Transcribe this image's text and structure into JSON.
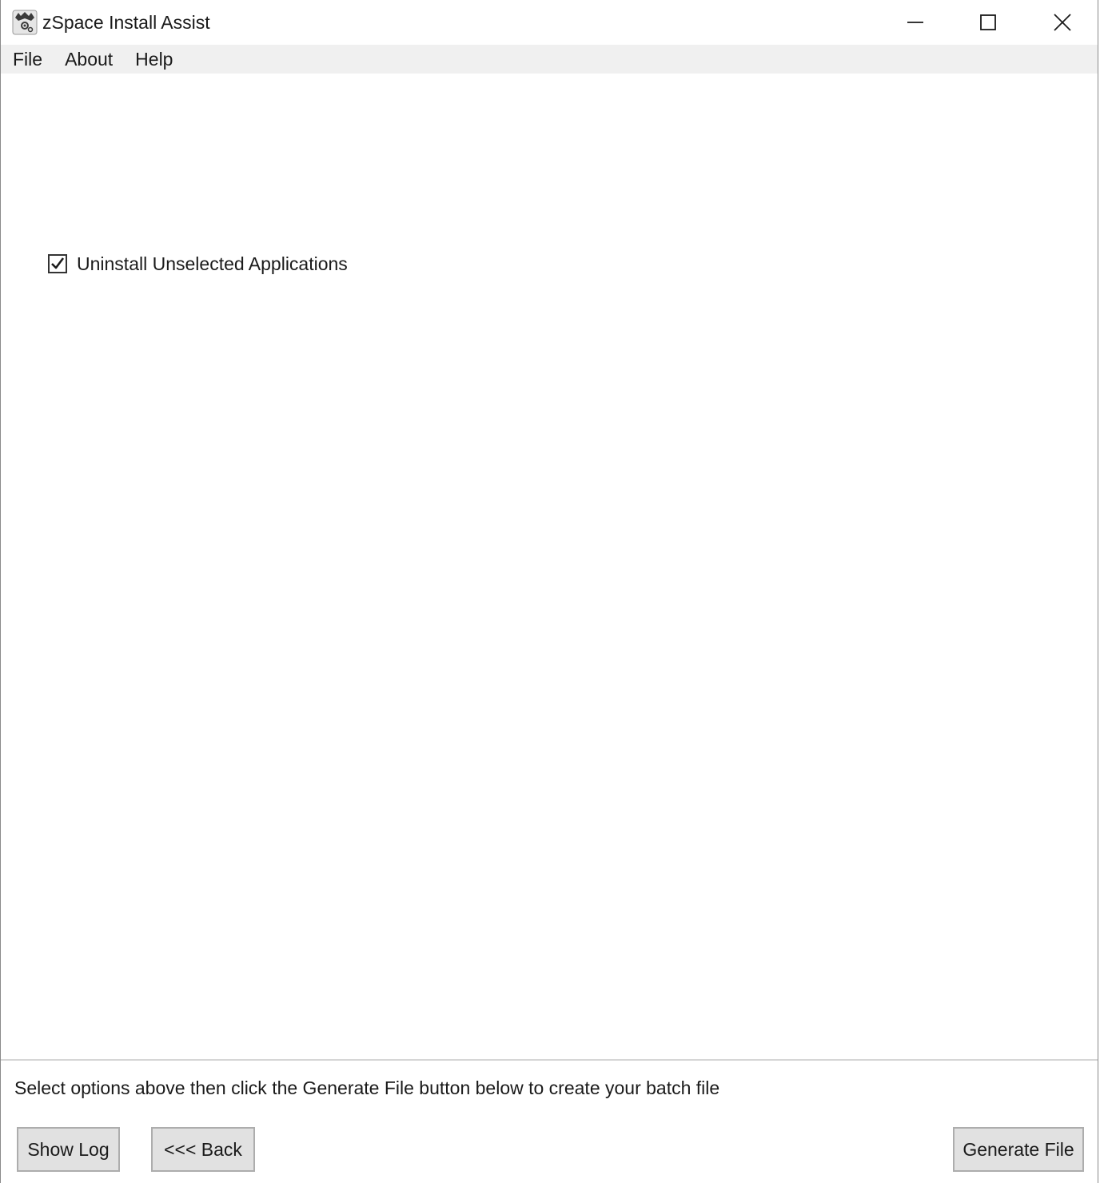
{
  "window": {
    "title": "zSpace Install Assist",
    "icon": "zspace-app-icon"
  },
  "window_controls": {
    "minimize_icon": "minimize-icon",
    "maximize_icon": "maximize-icon",
    "close_icon": "close-icon"
  },
  "menubar": {
    "items": [
      {
        "label": "File"
      },
      {
        "label": "About"
      },
      {
        "label": "Help"
      }
    ]
  },
  "options": {
    "uninstall_unselected": {
      "label": "Uninstall Unselected Applications",
      "checked": true
    }
  },
  "footer": {
    "instruction": "Select options above then click the Generate File button below to create your batch file",
    "show_log_label": "Show Log",
    "back_label": "<<< Back",
    "generate_label": "Generate File"
  },
  "colors": {
    "menubar_bg": "#f0f0f0",
    "button_bg": "#e1e1e1",
    "button_border": "#adadad"
  }
}
